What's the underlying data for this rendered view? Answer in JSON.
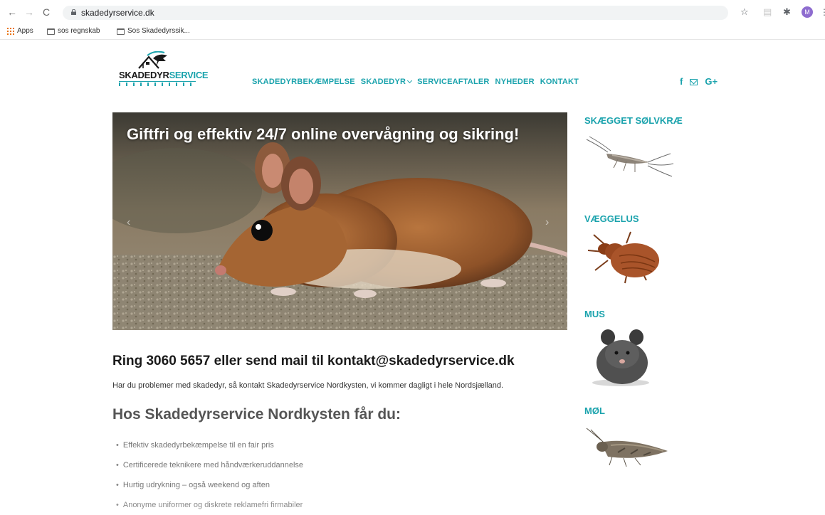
{
  "browser": {
    "url": "skadedyrservice.dk",
    "avatar_initial": "M",
    "bookmarks": [
      {
        "label": "Apps"
      },
      {
        "label": "sos regnskab"
      },
      {
        "label": "Sos Skadedyrssik..."
      }
    ]
  },
  "site": {
    "logo_text_dark": "SKADEDYR",
    "logo_text_accent": "SERVICE",
    "nav": [
      {
        "label": "SKADEDYRBEKÆMPELSE"
      },
      {
        "label": "SKADEDYR"
      },
      {
        "label": "SERVICEAFTALER"
      },
      {
        "label": "NYHEDER"
      },
      {
        "label": "KONTAKT"
      }
    ],
    "social": {
      "facebook": "f",
      "google": "G+"
    },
    "colors": {
      "accent": "#1ba3ad"
    }
  },
  "hero": {
    "caption": "Giftfri og effektiv 24/7 online overvågning og sikring!"
  },
  "content": {
    "contact_heading": "Ring 3060 5657 eller send mail til kontakt@skadedyrservice.dk",
    "intro": "Har du problemer med skadedyr, så kontakt Skadedyrservice Nordkysten, vi kommer dagligt i hele Nordsjælland.",
    "offer_heading": "Hos Skadedyrservice Nordkysten får du:",
    "benefits": [
      "Effektiv skadedyrbekæmpelse til en fair pris",
      "Certificerede teknikere med håndværkeruddannelse",
      "Hurtig udrykning – også weekend og aften",
      "Anonyme uniformer og diskrete reklamefri firmabiler"
    ]
  },
  "sidebar": {
    "pests": [
      {
        "title": "SKÆGGET SØLVKRÆ"
      },
      {
        "title": "VÆGGELUS"
      },
      {
        "title": "MUS"
      },
      {
        "title": "MØL"
      }
    ]
  }
}
